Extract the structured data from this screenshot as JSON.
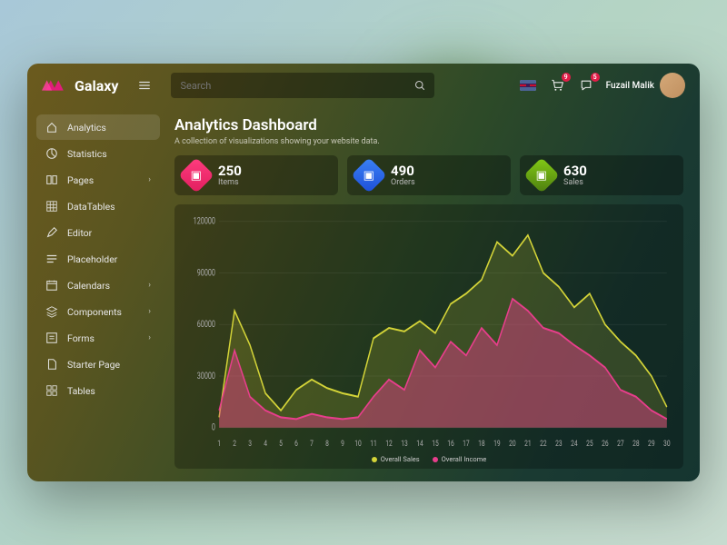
{
  "brand": {
    "name": "Galaxy"
  },
  "search": {
    "placeholder": "Search"
  },
  "topbar": {
    "cart_badge": "9",
    "notif_badge": "5",
    "user_name": "Fuzail Malik"
  },
  "sidebar": {
    "items": [
      {
        "label": "Analytics",
        "icon": "home",
        "active": true
      },
      {
        "label": "Statistics",
        "icon": "pie"
      },
      {
        "label": "Pages",
        "icon": "book",
        "expandable": true
      },
      {
        "label": "DataTables",
        "icon": "grid"
      },
      {
        "label": "Editor",
        "icon": "edit"
      },
      {
        "label": "Placeholder",
        "icon": "lines"
      },
      {
        "label": "Calendars",
        "icon": "calendar",
        "expandable": true
      },
      {
        "label": "Components",
        "icon": "layers",
        "expandable": true
      },
      {
        "label": "Forms",
        "icon": "form",
        "expandable": true
      },
      {
        "label": "Starter Page",
        "icon": "page"
      },
      {
        "label": "Tables",
        "icon": "tiles"
      }
    ]
  },
  "page": {
    "title": "Analytics Dashboard",
    "subtitle": "A collection of visualizations showing your website data."
  },
  "stats": [
    {
      "value": "250",
      "label": "Items",
      "color": "pink"
    },
    {
      "value": "490",
      "label": "Orders",
      "color": "blue"
    },
    {
      "value": "630",
      "label": "Sales",
      "color": "green"
    }
  ],
  "chart_data": {
    "type": "area",
    "x": [
      1,
      2,
      3,
      4,
      5,
      6,
      7,
      8,
      9,
      10,
      11,
      12,
      13,
      14,
      15,
      16,
      17,
      18,
      19,
      20,
      21,
      22,
      23,
      24,
      25,
      26,
      27,
      28,
      29,
      30
    ],
    "series": [
      {
        "name": "Overall Sales",
        "color": "#d4d438",
        "values": [
          6000,
          68000,
          48000,
          20000,
          10000,
          22000,
          28000,
          23000,
          20000,
          18000,
          52000,
          58000,
          56000,
          62000,
          55000,
          72000,
          78000,
          86000,
          108000,
          100000,
          112000,
          90000,
          82000,
          70000,
          78000,
          60000,
          50000,
          42000,
          30000,
          12000
        ]
      },
      {
        "name": "Overall Income",
        "color": "#e83e8c",
        "values": [
          10000,
          45000,
          18000,
          10000,
          6000,
          5000,
          8000,
          6000,
          5000,
          6000,
          18000,
          28000,
          22000,
          45000,
          35000,
          50000,
          42000,
          58000,
          48000,
          75000,
          68000,
          58000,
          55000,
          48000,
          42000,
          35000,
          22000,
          18000,
          10000,
          5000
        ]
      }
    ],
    "ylim": [
      0,
      120000
    ],
    "yticks": [
      0,
      30000,
      60000,
      90000,
      120000
    ],
    "xlabel": "",
    "ylabel": "",
    "title": ""
  },
  "legend": [
    {
      "label": "Overall Sales",
      "color": "#d4d438"
    },
    {
      "label": "Overall Income",
      "color": "#e83e8c"
    }
  ]
}
